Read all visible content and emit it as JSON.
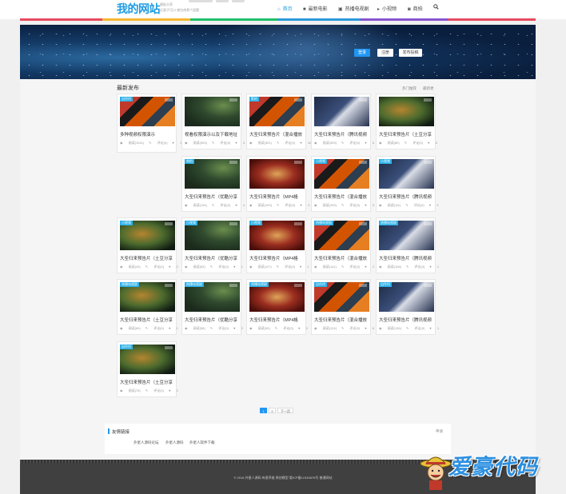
{
  "header": {
    "logo": "我的网站",
    "tagline_1": "模板分享",
    "tagline_2": "近意子可口 感台南骨个居题",
    "nav": [
      {
        "label": "首页",
        "icon": "home-icon",
        "active": true
      },
      {
        "label": "最新电影",
        "icon": "video-camera-icon",
        "active": false
      },
      {
        "label": "热播电视剧",
        "icon": "tv-icon",
        "active": false
      },
      {
        "label": "小视频",
        "icon": "play-icon",
        "active": false
      },
      {
        "label": "商拍",
        "icon": "camera-icon",
        "active": false
      }
    ],
    "accent": "#1e9be0"
  },
  "banner": {
    "buttons": [
      "登录",
      "注册",
      "发布投稿"
    ]
  },
  "section": {
    "title": "最新发布",
    "tabs": [
      "热门推荐",
      "最新更"
    ]
  },
  "cards": [
    {
      "badge": "自作内",
      "title": "多种视频权限演示",
      "views": "阅读(1041)",
      "comments": "评论(0)",
      "likes": "14"
    },
    {
      "badge": "",
      "title": "视看权限演示以及下载地址",
      "views": "阅读(953)",
      "comments": "评论(0)",
      "likes": "4"
    },
    {
      "badge": "影拍",
      "title": "大圣归来预告片（混合播放",
      "views": "阅读(301)",
      "comments": "评论(0)",
      "likes": "10"
    },
    {
      "badge": "",
      "title": "大圣归来预告片（腾讯视频",
      "views": "阅读(309)",
      "comments": "评论(0)",
      "likes": "6"
    },
    {
      "badge": "",
      "title": "大圣归来预告片（土豆分享",
      "views": "阅读(80)",
      "comments": "评论(0)",
      "likes": "5"
    },
    {
      "badge": "商拍",
      "title": "大圣归来预告片（优酷分享",
      "views": "阅读(134)",
      "comments": "评论(0)",
      "likes": "4"
    },
    {
      "badge": "",
      "title": "大圣归来预告片（MP4格",
      "views": "阅读(193)",
      "comments": "评论(0)",
      "likes": "3"
    },
    {
      "badge": "小视频",
      "title": "大圣归来预告片（混合播放",
      "views": "阅读(193)",
      "comments": "评论(0)",
      "likes": "5"
    },
    {
      "badge": "小视频",
      "title": "大圣归来预告片（腾讯视频",
      "views": "阅读(111)",
      "comments": "评论(0)",
      "likes": "3"
    },
    {
      "badge": "小视频",
      "title": "大圣归来预告片（土豆分享",
      "views": "阅读(43)",
      "comments": "评论(0)",
      "likes": "2"
    },
    {
      "badge": "小视频",
      "title": "大圣归来预告片（优酷分享",
      "views": "阅读(63)",
      "comments": "评论(0)",
      "likes": "1"
    },
    {
      "badge": "小视频",
      "title": "大圣归来预告片（MP4格",
      "views": "阅读(117)",
      "comments": "评论(0)",
      "likes": "1"
    },
    {
      "badge": "热播电视剧",
      "title": "大圣归来预告片（混合播放",
      "views": "阅读(141)",
      "comments": "评论(0)",
      "likes": "2"
    },
    {
      "badge": "热播电视剧",
      "title": "大圣归来预告片（腾讯视频",
      "views": "阅读(106)",
      "comments": "评论(0)",
      "likes": "1"
    },
    {
      "badge": "热播电视剧",
      "title": "大圣归来预告片（土豆分享",
      "views": "阅读(60)",
      "comments": "评论(0)",
      "likes": "1"
    },
    {
      "badge": "热播电视剧",
      "title": "大圣归来预告片（优酷分享",
      "views": "阅读(58)",
      "comments": "评论(0)",
      "likes": "2"
    },
    {
      "badge": "热播电视剧",
      "title": "大圣归来预告片（MP4格",
      "views": "阅读(90)",
      "comments": "评论(0)",
      "likes": "3"
    },
    {
      "badge": "自作内",
      "title": "大圣归来预告片（混合播放",
      "views": "阅读(124)",
      "comments": "评论(0)",
      "likes": "6"
    },
    {
      "badge": "自作内",
      "title": "大圣归来预告片（腾讯视频",
      "views": "阅读(136)",
      "comments": "评论(0)",
      "likes": "1"
    },
    {
      "badge": "自作内",
      "title": "大圣归来预告片（土豆分享",
      "views": "阅读(75)",
      "comments": "评论(0)",
      "likes": "2"
    }
  ],
  "pagination": [
    "1",
    "2",
    "下一页"
  ],
  "friend_links": {
    "title": "友情链接",
    "apply": "申请",
    "items": [
      "外星人源码论坛",
      "外星人源码",
      "外星人软件下载"
    ]
  },
  "footer": {
    "copyright": "© 2016 外星人源码 有意序维 原创模型 版ICP备12345678号 普通网站"
  },
  "watermark": {
    "text": "爱豪代码"
  }
}
